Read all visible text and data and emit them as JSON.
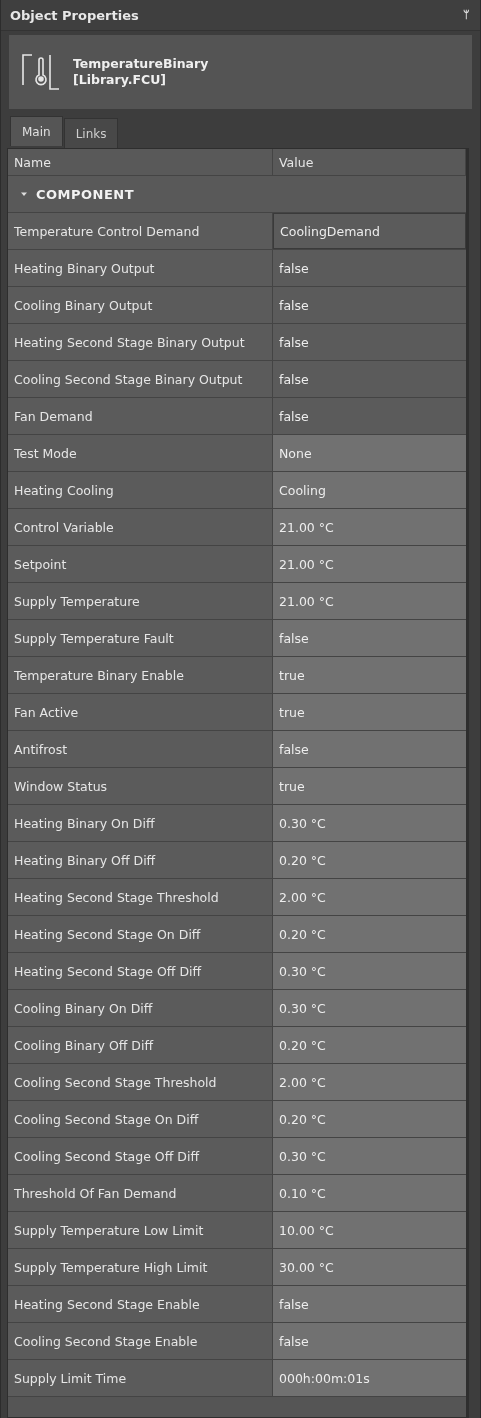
{
  "panel": {
    "title": "Object Properties",
    "pin": "ᛘ"
  },
  "object": {
    "name": "TemperatureBinary",
    "library": "[Library.FCU]"
  },
  "tabs": [
    {
      "label": "Main",
      "selected": true
    },
    {
      "label": "Links",
      "selected": false
    }
  ],
  "table": {
    "columns": [
      "Name",
      "Value"
    ],
    "group": {
      "label": "COMPONENT",
      "expanded": true
    },
    "rows": [
      {
        "name": "Temperature Control Demand",
        "value": "CoolingDemand",
        "kind": "output",
        "selected": true
      },
      {
        "name": "Heating Binary Output",
        "value": "false",
        "kind": "output",
        "selected": false
      },
      {
        "name": "Cooling Binary Output",
        "value": "false",
        "kind": "output",
        "selected": false
      },
      {
        "name": "Heating Second Stage Binary Output",
        "value": "false",
        "kind": "output",
        "selected": false
      },
      {
        "name": "Cooling Second Stage Binary Output",
        "value": "false",
        "kind": "output",
        "selected": false
      },
      {
        "name": "Fan Demand",
        "value": "false",
        "kind": "output",
        "selected": false
      },
      {
        "name": "Test Mode",
        "value": "None",
        "kind": "input",
        "selected": false
      },
      {
        "name": "Heating Cooling",
        "value": "Cooling",
        "kind": "input",
        "selected": false
      },
      {
        "name": "Control Variable",
        "value": "21.00 °C",
        "kind": "input",
        "selected": false
      },
      {
        "name": "Setpoint",
        "value": "21.00 °C",
        "kind": "input",
        "selected": false
      },
      {
        "name": "Supply Temperature",
        "value": "21.00 °C",
        "kind": "input",
        "selected": false
      },
      {
        "name": "Supply Temperature Fault",
        "value": "false",
        "kind": "input",
        "selected": false
      },
      {
        "name": "Temperature Binary Enable",
        "value": "true",
        "kind": "input",
        "selected": false
      },
      {
        "name": "Fan Active",
        "value": "true",
        "kind": "input",
        "selected": false
      },
      {
        "name": "Antifrost",
        "value": "false",
        "kind": "input",
        "selected": false
      },
      {
        "name": "Window Status",
        "value": "true",
        "kind": "input",
        "selected": false
      },
      {
        "name": "Heating Binary On Diff",
        "value": "0.30 °C",
        "kind": "input",
        "selected": false
      },
      {
        "name": "Heating Binary Off Diff",
        "value": "0.20 °C",
        "kind": "input",
        "selected": false
      },
      {
        "name": "Heating Second Stage Threshold",
        "value": "2.00 °C",
        "kind": "input",
        "selected": false
      },
      {
        "name": "Heating Second Stage On Diff",
        "value": "0.20 °C",
        "kind": "input",
        "selected": false
      },
      {
        "name": "Heating Second Stage Off Diff",
        "value": "0.30 °C",
        "kind": "input",
        "selected": false
      },
      {
        "name": "Cooling Binary On Diff",
        "value": "0.30 °C",
        "kind": "input",
        "selected": false
      },
      {
        "name": "Cooling Binary Off Diff",
        "value": "0.20 °C",
        "kind": "input",
        "selected": false
      },
      {
        "name": "Cooling Second Stage Threshold",
        "value": "2.00 °C",
        "kind": "input",
        "selected": false
      },
      {
        "name": "Cooling Second Stage On Diff",
        "value": "0.20 °C",
        "kind": "input",
        "selected": false
      },
      {
        "name": "Cooling Second Stage Off Diff",
        "value": "0.30 °C",
        "kind": "input",
        "selected": false
      },
      {
        "name": "Threshold Of Fan Demand",
        "value": "0.10 °C",
        "kind": "input",
        "selected": false
      },
      {
        "name": "Supply Temperature Low Limit",
        "value": "10.00 °C",
        "kind": "input",
        "selected": false
      },
      {
        "name": "Supply Temperature High Limit",
        "value": "30.00 °C",
        "kind": "input",
        "selected": false
      },
      {
        "name": "Heating Second Stage Enable",
        "value": "false",
        "kind": "input",
        "selected": false
      },
      {
        "name": "Cooling Second Stage Enable",
        "value": "false",
        "kind": "input",
        "selected": false
      },
      {
        "name": "Supply Limit Time",
        "value": "000h:00m:01s",
        "kind": "input",
        "selected": false
      }
    ]
  }
}
